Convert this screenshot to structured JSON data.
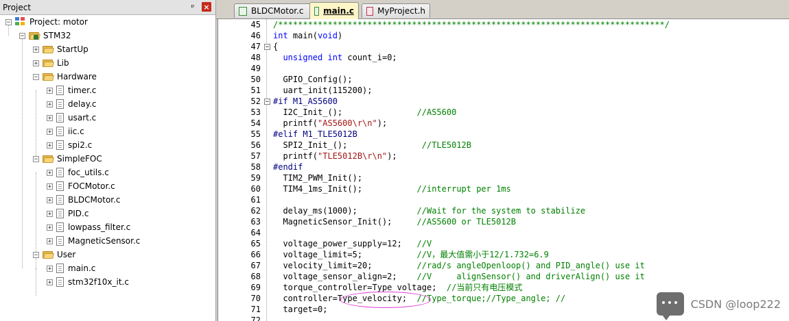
{
  "project_pane": {
    "title": "Project",
    "pin_glyph": "ᵖ",
    "close_glyph": "×",
    "tree": [
      {
        "label": "Project: motor",
        "kind": "project",
        "depth": 0,
        "expander": "−"
      },
      {
        "label": "STM32",
        "kind": "target",
        "depth": 1,
        "expander": "−"
      },
      {
        "label": "StartUp",
        "kind": "folder",
        "depth": 2,
        "expander": "+"
      },
      {
        "label": "Lib",
        "kind": "folder",
        "depth": 2,
        "expander": "+"
      },
      {
        "label": "Hardware",
        "kind": "folder",
        "depth": 2,
        "expander": "−"
      },
      {
        "label": "timer.c",
        "kind": "file",
        "depth": 3,
        "expander": "+"
      },
      {
        "label": "delay.c",
        "kind": "file",
        "depth": 3,
        "expander": "+"
      },
      {
        "label": "usart.c",
        "kind": "file",
        "depth": 3,
        "expander": "+"
      },
      {
        "label": "iic.c",
        "kind": "file",
        "depth": 3,
        "expander": "+"
      },
      {
        "label": "spi2.c",
        "kind": "file",
        "depth": 3,
        "expander": "+"
      },
      {
        "label": "SimpleFOC",
        "kind": "folder",
        "depth": 2,
        "expander": "−"
      },
      {
        "label": "foc_utils.c",
        "kind": "file",
        "depth": 3,
        "expander": "+"
      },
      {
        "label": "FOCMotor.c",
        "kind": "file",
        "depth": 3,
        "expander": "+"
      },
      {
        "label": "BLDCMotor.c",
        "kind": "file",
        "depth": 3,
        "expander": "+"
      },
      {
        "label": "PID.c",
        "kind": "file",
        "depth": 3,
        "expander": "+"
      },
      {
        "label": "lowpass_filter.c",
        "kind": "file",
        "depth": 3,
        "expander": "+"
      },
      {
        "label": "MagneticSensor.c",
        "kind": "file",
        "depth": 3,
        "expander": "+"
      },
      {
        "label": "User",
        "kind": "folder",
        "depth": 2,
        "expander": "−"
      },
      {
        "label": "main.c",
        "kind": "file",
        "depth": 3,
        "expander": "+"
      },
      {
        "label": "stm32f10x_it.c",
        "kind": "file",
        "depth": 3,
        "expander": "+"
      }
    ]
  },
  "tabs": [
    {
      "label": "BLDCMotor.c",
      "type": "c",
      "active": false
    },
    {
      "label": "main.c",
      "type": "c",
      "active": true
    },
    {
      "label": "MyProject.h",
      "type": "h",
      "active": false
    }
  ],
  "code": {
    "lines": [
      {
        "n": "45",
        "fold": "",
        "tokens": [
          [
            "cmt",
            "/******************************************************************************/"
          ]
        ]
      },
      {
        "n": "46",
        "fold": "",
        "tokens": [
          [
            "kw",
            "int"
          ],
          [
            "plain",
            " main("
          ],
          [
            "kw",
            "void"
          ],
          [
            "plain",
            ")"
          ]
        ]
      },
      {
        "n": "47",
        "fold": "−",
        "tokens": [
          [
            "plain",
            "{"
          ]
        ]
      },
      {
        "n": "48",
        "fold": "",
        "tokens": [
          [
            "plain",
            "  "
          ],
          [
            "kw",
            "unsigned"
          ],
          [
            "plain",
            " "
          ],
          [
            "kw",
            "int"
          ],
          [
            "plain",
            " count_i=0;"
          ]
        ]
      },
      {
        "n": "49",
        "fold": "",
        "tokens": []
      },
      {
        "n": "50",
        "fold": "",
        "tokens": [
          [
            "plain",
            "  GPIO_Config();"
          ]
        ]
      },
      {
        "n": "51",
        "fold": "",
        "tokens": [
          [
            "plain",
            "  uart_init(115200);"
          ]
        ]
      },
      {
        "n": "52",
        "fold": "−",
        "tokens": [
          [
            "pp",
            "#if M1_AS5600"
          ]
        ]
      },
      {
        "n": "53",
        "fold": "",
        "tokens": [
          [
            "plain",
            "  I2C_Init_();               "
          ],
          [
            "cmt",
            "//AS5600"
          ]
        ]
      },
      {
        "n": "54",
        "fold": "",
        "tokens": [
          [
            "plain",
            "  printf("
          ],
          [
            "str",
            "\"AS5600\\r\\n\""
          ],
          [
            "plain",
            ");"
          ]
        ]
      },
      {
        "n": "55",
        "fold": "",
        "tokens": [
          [
            "pp",
            "#elif M1_TLE5012B"
          ]
        ]
      },
      {
        "n": "56",
        "fold": "",
        "tokens": [
          [
            "plain",
            "  SPI2_Init_();               "
          ],
          [
            "cmt",
            "//TLE5012B"
          ]
        ]
      },
      {
        "n": "57",
        "fold": "",
        "tokens": [
          [
            "plain",
            "  printf("
          ],
          [
            "str",
            "\"TLE5012B\\r\\n\""
          ],
          [
            "plain",
            ");"
          ]
        ]
      },
      {
        "n": "58",
        "fold": "",
        "tokens": [
          [
            "pp",
            "#endif"
          ]
        ]
      },
      {
        "n": "59",
        "fold": "",
        "tokens": [
          [
            "plain",
            "  TIM2_PWM_Init();"
          ]
        ]
      },
      {
        "n": "60",
        "fold": "",
        "tokens": [
          [
            "plain",
            "  TIM4_1ms_Init();           "
          ],
          [
            "cmt",
            "//interrupt per 1ms"
          ]
        ]
      },
      {
        "n": "61",
        "fold": "",
        "tokens": []
      },
      {
        "n": "62",
        "fold": "",
        "tokens": [
          [
            "plain",
            "  delay_ms(1000);            "
          ],
          [
            "cmt",
            "//Wait for the system to stabilize"
          ]
        ]
      },
      {
        "n": "63",
        "fold": "",
        "tokens": [
          [
            "plain",
            "  MagneticSensor_Init();     "
          ],
          [
            "cmt",
            "//AS5600 or TLE5012B"
          ]
        ]
      },
      {
        "n": "64",
        "fold": "",
        "tokens": []
      },
      {
        "n": "65",
        "fold": "",
        "tokens": [
          [
            "plain",
            "  voltage_power_supply=12;   "
          ],
          [
            "cmt",
            "//V"
          ]
        ]
      },
      {
        "n": "66",
        "fold": "",
        "tokens": [
          [
            "plain",
            "  voltage_limit=5;           "
          ],
          [
            "cmt",
            "//V，最大值需小于12/1.732=6.9"
          ]
        ]
      },
      {
        "n": "67",
        "fold": "",
        "tokens": [
          [
            "plain",
            "  velocity_limit=20;         "
          ],
          [
            "cmt",
            "//rad/s angleOpenloop() and PID_angle() use it"
          ]
        ]
      },
      {
        "n": "68",
        "fold": "",
        "tokens": [
          [
            "plain",
            "  voltage_sensor_align=2;    "
          ],
          [
            "cmt",
            "//V     alignSensor() and driverAlign() use it"
          ]
        ]
      },
      {
        "n": "69",
        "fold": "",
        "tokens": [
          [
            "plain",
            "  torque_controller=Type_voltage;  "
          ],
          [
            "cmt",
            "//当前只有电压模式"
          ]
        ]
      },
      {
        "n": "70",
        "fold": "",
        "tokens": [
          [
            "plain",
            "  controller=Type_velocity;  "
          ],
          [
            "cmt",
            "//Type_torque;//Type_angle; //"
          ]
        ]
      },
      {
        "n": "71",
        "fold": "",
        "tokens": [
          [
            "plain",
            "  target=0;"
          ]
        ]
      },
      {
        "n": "72",
        "fold": "",
        "tokens": []
      }
    ]
  },
  "watermark": {
    "icon": "chat-bubble-icon",
    "text": "CSDN @loop222"
  },
  "colors": {
    "keyword": "#0000ff",
    "comment": "#008000",
    "string": "#a31515",
    "preprocessor": "#000080",
    "highlight_ellipse": "#e23ad6",
    "active_tab": "#fff6c8"
  }
}
